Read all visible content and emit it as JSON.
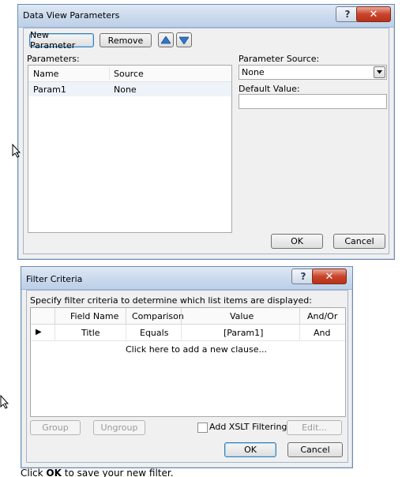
{
  "data_view_parameters": {
    "title": "Data View Parameters",
    "new_parameter_label": "New Parameter",
    "remove_label": "Remove",
    "parameters_label": "Parameters:",
    "columns": [
      "Name",
      "Source"
    ],
    "rows": [
      {
        "name": "Param1",
        "source": "None"
      }
    ],
    "parameter_source_label": "Parameter Source:",
    "parameter_source_value": "None",
    "default_value_label": "Default Value:",
    "default_value": "",
    "ok_label": "OK",
    "cancel_label": "Cancel"
  },
  "filter_criteria": {
    "title": "Filter Criteria",
    "instructions": "Specify filter criteria to determine which list items are displayed:",
    "columns": [
      "Field Name",
      "Comparison",
      "Value",
      "And/Or"
    ],
    "rows": [
      {
        "field": "Title",
        "comparison": "Equals",
        "value": "[Param1]",
        "andor": "And"
      }
    ],
    "add_clause": "Click here to add a new clause...",
    "group_label": "Group",
    "ungroup_label": "Ungroup",
    "add_xslt_label": "Add XSLT Filtering",
    "add_xslt_checked": false,
    "edit_label": "Edit...",
    "ok_label": "OK",
    "cancel_label": "Cancel"
  },
  "footer": {
    "prefix": "Click ",
    "ok_word": "OK",
    "suffix": " to save your new filter."
  },
  "icons": {
    "help": "help-icon",
    "close": "close-icon",
    "move_up": "arrow-up-icon",
    "move_down": "arrow-down-icon"
  },
  "colors": {
    "title_bar": "#c8d8ec",
    "close_button": "#c9442a",
    "dialog_face": "#f0f0f0",
    "default_button_border": "#3c7fb1"
  }
}
